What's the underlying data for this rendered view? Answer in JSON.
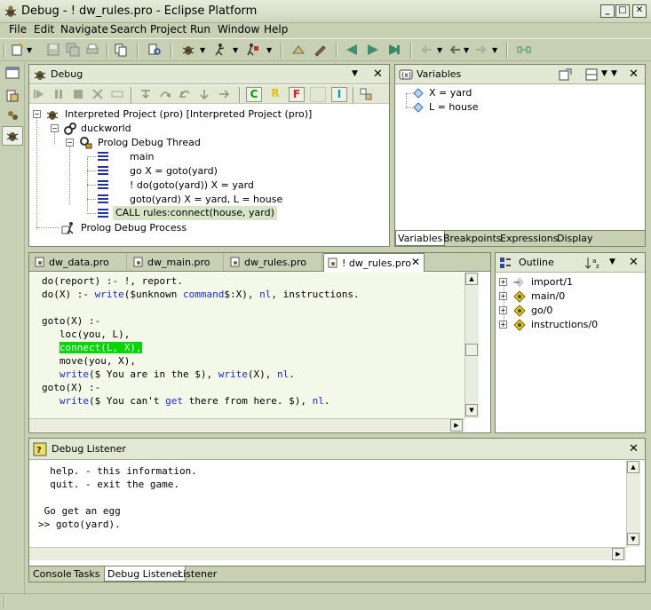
{
  "window": {
    "title": "Debug - ! dw_rules.pro - Eclipse Platform",
    "minimize": "_",
    "maximize": "□",
    "close": "✕"
  },
  "menu": [
    "File",
    "Edit",
    "Navigate",
    "Search",
    "Project",
    "Run",
    "Window",
    "Help"
  ],
  "debug_view": {
    "title": "Debug",
    "toolbar_letters": [
      "C",
      "R",
      "F",
      "I"
    ],
    "tree": {
      "root": "Interpreted Project (pro) [Interpreted Project (pro)]",
      "process_node": "duckworld",
      "thread": "Prolog Debug Thread",
      "frames": [
        "main",
        "go  X = goto(yard)",
        "! do(goto(yard))  X = yard",
        "goto(yard)  X = yard, L = house",
        "CALL rules:connect(house, yard)"
      ],
      "process": "Prolog Debug Process"
    }
  },
  "variables_view": {
    "title": "Variables",
    "items": [
      "X = yard",
      "L = house"
    ],
    "tabs": [
      "Variables",
      "Breakpoints",
      "Expressions",
      "Display"
    ]
  },
  "editor": {
    "tabs": [
      "dw_data.pro",
      "dw_main.pro",
      "dw_rules.pro",
      "! dw_rules.pro"
    ],
    "lines": [
      [
        {
          "t": "do(report) :- !, report."
        }
      ],
      [
        {
          "t": "do(X) :- "
        },
        {
          "t": "write",
          "c": "kw"
        },
        {
          "t": "($unknown "
        },
        {
          "t": "command",
          "c": "kw"
        },
        {
          "t": "$:X), "
        },
        {
          "t": "nl",
          "c": "kw"
        },
        {
          "t": ", instructions."
        }
      ],
      [
        {
          "t": ""
        }
      ],
      [
        {
          "t": "goto(X) :-"
        }
      ],
      [
        {
          "t": "   loc(you, L),"
        }
      ],
      [
        {
          "t": "   "
        },
        {
          "t": "connect(L, X),",
          "c": "hl"
        }
      ],
      [
        {
          "t": "   move(you, X),"
        }
      ],
      [
        {
          "t": "   "
        },
        {
          "t": "write",
          "c": "kw"
        },
        {
          "t": "($ You are in the $), "
        },
        {
          "t": "write",
          "c": "kw"
        },
        {
          "t": "(X), "
        },
        {
          "t": "nl",
          "c": "kw"
        },
        {
          "t": "."
        }
      ],
      [
        {
          "t": "goto(X) :-"
        }
      ],
      [
        {
          "t": "   "
        },
        {
          "t": "write",
          "c": "kw"
        },
        {
          "t": "($ You can't "
        },
        {
          "t": "get",
          "c": "kw"
        },
        {
          "t": " there from here. $), "
        },
        {
          "t": "nl",
          "c": "kw"
        },
        {
          "t": "."
        }
      ]
    ]
  },
  "outline_view": {
    "title": "Outline",
    "items": [
      "import/1",
      "main/0",
      "go/0",
      "instructions/0"
    ]
  },
  "listener_view": {
    "title": "Debug Listener",
    "lines": [
      "  help. - this information.",
      "  quit. - exit the game.",
      "",
      " Go get an egg",
      ">> goto(yard)."
    ],
    "tabs": [
      "Console",
      "Tasks",
      "Debug Listener",
      "Listener"
    ]
  }
}
